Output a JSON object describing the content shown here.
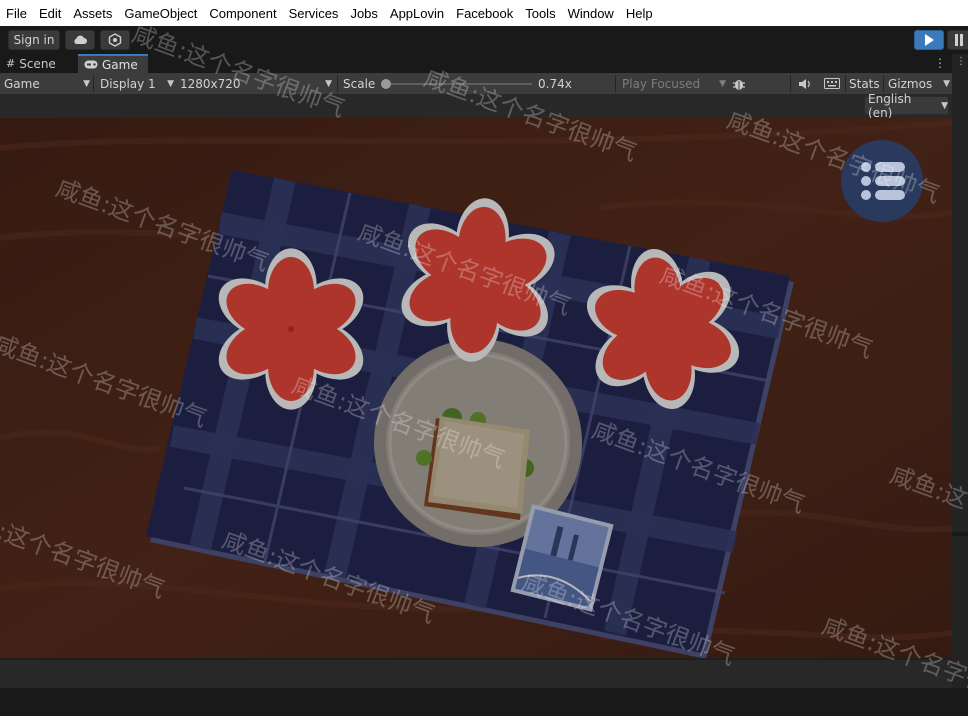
{
  "menubar": {
    "items": [
      "File",
      "Edit",
      "Assets",
      "GameObject",
      "Component",
      "Services",
      "Jobs",
      "AppLovin",
      "Facebook",
      "Tools",
      "Window",
      "Help"
    ]
  },
  "toolbar": {
    "sign_in_label": "Sign in",
    "cloud_icon": "cloud-icon",
    "collab_icon": "collab-icon",
    "play_icon": "play-icon",
    "pause_icon": "pause-icon"
  },
  "tabs": [
    {
      "label": "Scene",
      "icon": "grid-icon"
    },
    {
      "label": "Game",
      "icon": "gamepad-icon"
    }
  ],
  "gamebar": {
    "view_mode": "Game",
    "display": "Display 1",
    "resolution": "1280x720",
    "scale_label": "Scale",
    "scale_value": "0.74x",
    "play_mode": "Play Focused",
    "stats_label": "Stats",
    "gizmos_label": "Gizmos"
  },
  "locale": {
    "selected": "English (en)"
  },
  "watermark_text": "咸鱼:这个名字很帅气",
  "colors": {
    "accent": "#3a79bb",
    "flower": "#f04a3e",
    "cloth": "#262a58",
    "table": "#5a2e1e"
  }
}
